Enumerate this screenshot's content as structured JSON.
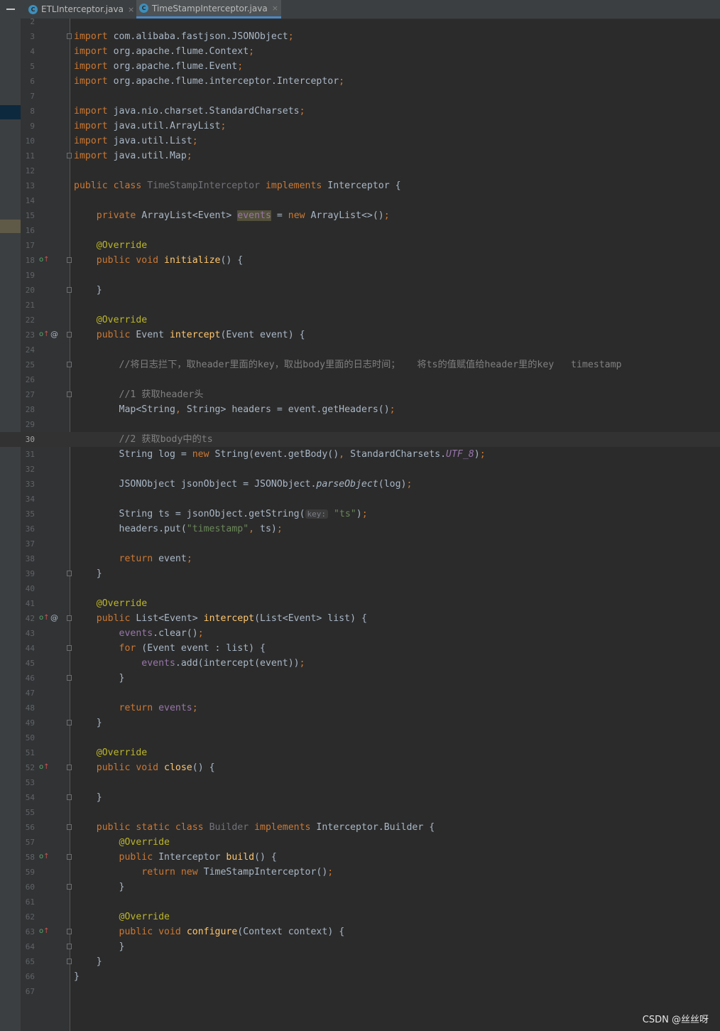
{
  "tabs": [
    {
      "icon": "java-class-icon",
      "icon_glyph": "C",
      "label": "ETLInterceptor.java",
      "close": "×"
    },
    {
      "icon": "java-class-icon",
      "icon_glyph": "C",
      "label": "TimeStampInterceptor.java",
      "close": "×"
    }
  ],
  "editor": {
    "current_line": "30",
    "lines": [
      {
        "n": "2",
        "tokens": []
      },
      {
        "n": "3",
        "fold": true,
        "tokens": [
          {
            "t": "import",
            "c": "kw"
          },
          {
            "t": " com.alibaba.fastjson.JSONObject"
          },
          {
            "t": ";",
            "c": "kw"
          }
        ]
      },
      {
        "n": "4",
        "tokens": [
          {
            "t": "import",
            "c": "kw"
          },
          {
            "t": " org.apache.flume.Context"
          },
          {
            "t": ";",
            "c": "kw"
          }
        ]
      },
      {
        "n": "5",
        "tokens": [
          {
            "t": "import",
            "c": "kw"
          },
          {
            "t": " org.apache.flume.Event"
          },
          {
            "t": ";",
            "c": "kw"
          }
        ]
      },
      {
        "n": "6",
        "tokens": [
          {
            "t": "import",
            "c": "kw"
          },
          {
            "t": " org.apache.flume.interceptor.Interceptor"
          },
          {
            "t": ";",
            "c": "kw"
          }
        ]
      },
      {
        "n": "7",
        "tokens": []
      },
      {
        "n": "8",
        "tokens": [
          {
            "t": "import",
            "c": "kw"
          },
          {
            "t": " java.nio.charset.StandardCharsets"
          },
          {
            "t": ";",
            "c": "kw"
          }
        ]
      },
      {
        "n": "9",
        "tokens": [
          {
            "t": "import",
            "c": "kw"
          },
          {
            "t": " java.util.ArrayList"
          },
          {
            "t": ";",
            "c": "kw"
          }
        ]
      },
      {
        "n": "10",
        "tokens": [
          {
            "t": "import",
            "c": "kw"
          },
          {
            "t": " java.util.List"
          },
          {
            "t": ";",
            "c": "kw"
          }
        ]
      },
      {
        "n": "11",
        "fold": true,
        "tokens": [
          {
            "t": "import",
            "c": "kw"
          },
          {
            "t": " java.util.Map"
          },
          {
            "t": ";",
            "c": "kw"
          }
        ]
      },
      {
        "n": "12",
        "tokens": []
      },
      {
        "n": "13",
        "tokens": [
          {
            "t": "public class ",
            "c": "kw"
          },
          {
            "t": "TimeStampInterceptor",
            "c": "gray"
          },
          {
            "t": " implements ",
            "c": "kw"
          },
          {
            "t": "Interceptor {"
          }
        ]
      },
      {
        "n": "14",
        "tokens": []
      },
      {
        "n": "15",
        "tokens": [
          {
            "t": "    "
          },
          {
            "t": "private ",
            "c": "kw"
          },
          {
            "t": "ArrayList<Event> "
          },
          {
            "t": "events",
            "c": "fd hl"
          },
          {
            "t": " = "
          },
          {
            "t": "new ",
            "c": "kw"
          },
          {
            "t": "ArrayList<>()"
          },
          {
            "t": ";",
            "c": "kw"
          }
        ]
      },
      {
        "n": "16",
        "tokens": []
      },
      {
        "n": "17",
        "tokens": [
          {
            "t": "    "
          },
          {
            "t": "@Override",
            "c": "an"
          }
        ]
      },
      {
        "n": "18",
        "gicon": true,
        "fold": true,
        "tokens": [
          {
            "t": "    "
          },
          {
            "t": "public void ",
            "c": "kw"
          },
          {
            "t": "initialize",
            "c": "fn"
          },
          {
            "t": "() {"
          }
        ]
      },
      {
        "n": "19",
        "tokens": []
      },
      {
        "n": "20",
        "fold": true,
        "tokens": [
          {
            "t": "    }"
          }
        ]
      },
      {
        "n": "21",
        "tokens": []
      },
      {
        "n": "22",
        "tokens": [
          {
            "t": "    "
          },
          {
            "t": "@Override",
            "c": "an"
          }
        ]
      },
      {
        "n": "23",
        "gicon": true,
        "at": true,
        "fold": true,
        "tokens": [
          {
            "t": "    "
          },
          {
            "t": "public ",
            "c": "kw"
          },
          {
            "t": "Event "
          },
          {
            "t": "intercept",
            "c": "fn"
          },
          {
            "t": "(Event event) {"
          }
        ]
      },
      {
        "n": "24",
        "tokens": []
      },
      {
        "n": "25",
        "fold": true,
        "tokens": [
          {
            "t": "        "
          },
          {
            "t": "//将日志拦下，取header里面的key，取出body里面的日志时间；   将ts的值赋值给header里的key   timestamp",
            "c": "cm"
          }
        ]
      },
      {
        "n": "26",
        "tokens": []
      },
      {
        "n": "27",
        "fold": true,
        "tokens": [
          {
            "t": "        "
          },
          {
            "t": "//1 获取header头",
            "c": "cm"
          }
        ]
      },
      {
        "n": "28",
        "tokens": [
          {
            "t": "        Map<String"
          },
          {
            "t": ", ",
            "c": "kw"
          },
          {
            "t": "String> headers = event.getHeaders()"
          },
          {
            "t": ";",
            "c": "kw"
          }
        ]
      },
      {
        "n": "29",
        "tokens": []
      },
      {
        "n": "30",
        "tokens": [
          {
            "t": "        "
          },
          {
            "t": "//2 获取body中的ts",
            "c": "cm"
          }
        ]
      },
      {
        "n": "31",
        "tokens": [
          {
            "t": "        String log = "
          },
          {
            "t": "new ",
            "c": "kw"
          },
          {
            "t": "String(event.getBody()"
          },
          {
            "t": ", ",
            "c": "kw"
          },
          {
            "t": "StandardCharsets."
          },
          {
            "t": "UTF_8",
            "c": "fd it"
          },
          {
            "t": ")"
          },
          {
            "t": ";",
            "c": "kw"
          }
        ]
      },
      {
        "n": "32",
        "tokens": []
      },
      {
        "n": "33",
        "tokens": [
          {
            "t": "        JSONObject jsonObject = JSONObject."
          },
          {
            "t": "parseObject",
            "c": "it"
          },
          {
            "t": "(log)"
          },
          {
            "t": ";",
            "c": "kw"
          }
        ]
      },
      {
        "n": "34",
        "tokens": []
      },
      {
        "n": "35",
        "tokens": [
          {
            "t": "        String ts = jsonObject.getString("
          },
          {
            "t": "key:",
            "c": "hint"
          },
          {
            "t": " "
          },
          {
            "t": "\"ts\"",
            "c": "st"
          },
          {
            "t": ")"
          },
          {
            "t": ";",
            "c": "kw"
          }
        ]
      },
      {
        "n": "36",
        "tokens": [
          {
            "t": "        headers.put("
          },
          {
            "t": "\"timestamp\"",
            "c": "st"
          },
          {
            "t": ", ",
            "c": "kw"
          },
          {
            "t": "ts)"
          },
          {
            "t": ";",
            "c": "kw"
          }
        ]
      },
      {
        "n": "37",
        "tokens": []
      },
      {
        "n": "38",
        "tokens": [
          {
            "t": "        "
          },
          {
            "t": "return ",
            "c": "kw"
          },
          {
            "t": "event"
          },
          {
            "t": ";",
            "c": "kw"
          }
        ]
      },
      {
        "n": "39",
        "fold": true,
        "tokens": [
          {
            "t": "    }"
          }
        ]
      },
      {
        "n": "40",
        "tokens": []
      },
      {
        "n": "41",
        "tokens": [
          {
            "t": "    "
          },
          {
            "t": "@Override",
            "c": "an"
          }
        ]
      },
      {
        "n": "42",
        "gicon": true,
        "at": true,
        "fold": true,
        "tokens": [
          {
            "t": "    "
          },
          {
            "t": "public ",
            "c": "kw"
          },
          {
            "t": "List<Event> "
          },
          {
            "t": "intercept",
            "c": "fn"
          },
          {
            "t": "(List<Event> list) {"
          }
        ]
      },
      {
        "n": "43",
        "tokens": [
          {
            "t": "        "
          },
          {
            "t": "events",
            "c": "fd"
          },
          {
            "t": ".clear()"
          },
          {
            "t": ";",
            "c": "kw"
          }
        ]
      },
      {
        "n": "44",
        "fold": true,
        "tokens": [
          {
            "t": "        "
          },
          {
            "t": "for ",
            "c": "kw"
          },
          {
            "t": "(Event event : list) {"
          }
        ]
      },
      {
        "n": "45",
        "tokens": [
          {
            "t": "            "
          },
          {
            "t": "events",
            "c": "fd"
          },
          {
            "t": ".add(intercept(event))"
          },
          {
            "t": ";",
            "c": "kw"
          }
        ]
      },
      {
        "n": "46",
        "fold": true,
        "tokens": [
          {
            "t": "        }"
          }
        ]
      },
      {
        "n": "47",
        "tokens": []
      },
      {
        "n": "48",
        "tokens": [
          {
            "t": "        "
          },
          {
            "t": "return ",
            "c": "kw"
          },
          {
            "t": "events",
            "c": "fd"
          },
          {
            "t": ";",
            "c": "kw"
          }
        ]
      },
      {
        "n": "49",
        "fold": true,
        "tokens": [
          {
            "t": "    }"
          }
        ]
      },
      {
        "n": "50",
        "tokens": []
      },
      {
        "n": "51",
        "tokens": [
          {
            "t": "    "
          },
          {
            "t": "@Override",
            "c": "an"
          }
        ]
      },
      {
        "n": "52",
        "gicon": true,
        "fold": true,
        "tokens": [
          {
            "t": "    "
          },
          {
            "t": "public void ",
            "c": "kw"
          },
          {
            "t": "close",
            "c": "fn"
          },
          {
            "t": "() {"
          }
        ]
      },
      {
        "n": "53",
        "tokens": []
      },
      {
        "n": "54",
        "fold": true,
        "tokens": [
          {
            "t": "    }"
          }
        ]
      },
      {
        "n": "55",
        "tokens": []
      },
      {
        "n": "56",
        "fold": true,
        "tokens": [
          {
            "t": "    "
          },
          {
            "t": "public static class ",
            "c": "kw"
          },
          {
            "t": "Builder",
            "c": "gray"
          },
          {
            "t": " implements ",
            "c": "kw"
          },
          {
            "t": "Interceptor.Builder {"
          }
        ]
      },
      {
        "n": "57",
        "tokens": [
          {
            "t": "        "
          },
          {
            "t": "@Override",
            "c": "an"
          }
        ]
      },
      {
        "n": "58",
        "gicon": true,
        "fold": true,
        "tokens": [
          {
            "t": "        "
          },
          {
            "t": "public ",
            "c": "kw"
          },
          {
            "t": "Interceptor "
          },
          {
            "t": "build",
            "c": "fn"
          },
          {
            "t": "() {"
          }
        ]
      },
      {
        "n": "59",
        "tokens": [
          {
            "t": "            "
          },
          {
            "t": "return new ",
            "c": "kw"
          },
          {
            "t": "TimeStampInterceptor()"
          },
          {
            "t": ";",
            "c": "kw"
          }
        ]
      },
      {
        "n": "60",
        "fold": true,
        "tokens": [
          {
            "t": "        }"
          }
        ]
      },
      {
        "n": "61",
        "tokens": []
      },
      {
        "n": "62",
        "tokens": [
          {
            "t": "        "
          },
          {
            "t": "@Override",
            "c": "an"
          }
        ]
      },
      {
        "n": "63",
        "gicon": true,
        "fold": true,
        "tokens": [
          {
            "t": "        "
          },
          {
            "t": "public void ",
            "c": "kw"
          },
          {
            "t": "configure",
            "c": "fn"
          },
          {
            "t": "(Context context) {"
          }
        ]
      },
      {
        "n": "64",
        "fold": true,
        "tokens": [
          {
            "t": "        }"
          }
        ]
      },
      {
        "n": "65",
        "fold": true,
        "tokens": [
          {
            "t": "    }"
          }
        ]
      },
      {
        "n": "66",
        "tokens": [
          {
            "t": "}"
          }
        ]
      },
      {
        "n": "67",
        "tokens": []
      }
    ]
  },
  "watermark": "CSDN @丝丝呀",
  "colors": {
    "background": "#2b2b2b",
    "keyword": "#cc7832",
    "annotation": "#bbb529",
    "method": "#ffc66d",
    "field": "#9876aa",
    "string": "#6a8759",
    "comment": "#808080"
  }
}
